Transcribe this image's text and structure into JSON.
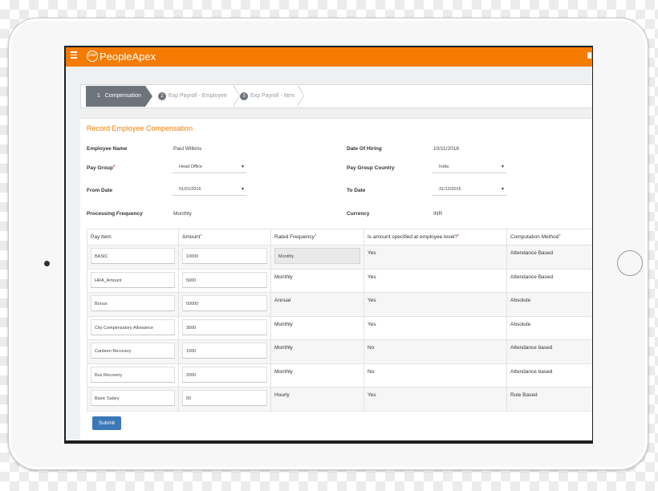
{
  "app": {
    "brand": "PeopleApex",
    "logo_text": "pax"
  },
  "steps": [
    {
      "num": "1",
      "label": "Compensation"
    },
    {
      "num": "2",
      "label": "Exp Payroll - Employee"
    },
    {
      "num": "3",
      "label": "Exp Payroll - Item"
    }
  ],
  "form": {
    "title": "Record Employee Compensation",
    "employee_name_label": "Employee Name",
    "employee_name": "Paul Wilkins",
    "date_of_hiring_label": "Date Of Hiring",
    "date_of_hiring": "10/11/2016",
    "pay_group_label": "Pay Group",
    "pay_group": "Head Office",
    "pay_group_country_label": "Pay Group Country",
    "pay_group_country": "India",
    "from_date_label": "From Date",
    "from_date": "01/01/2016",
    "to_date_label": "To Date",
    "to_date": "31/12/2016",
    "processing_frequency_label": "Processing Frequency",
    "processing_frequency": "Monthly",
    "currency_label": "Currency",
    "currency": "INR",
    "required_mark": "*"
  },
  "table": {
    "headers": [
      "Pay Item",
      "Amount",
      "Rated Frequency",
      "Is amount specified at employee level?",
      "Computation Method"
    ],
    "rows": [
      {
        "pay_item": "BASIC",
        "amount": "10000",
        "frequency": "Monthly",
        "employee_level": "Yes",
        "method": "Attendance Based"
      },
      {
        "pay_item": "HRA_Amount",
        "amount": "5000",
        "frequency": "Monthly",
        "employee_level": "Yes",
        "method": "Attendance Based"
      },
      {
        "pay_item": "Bonus",
        "amount": "50000",
        "frequency": "Annual",
        "employee_level": "Yes",
        "method": "Absolute"
      },
      {
        "pay_item": "City Compensatory Allowance",
        "amount": "3000",
        "frequency": "Monthly",
        "employee_level": "Yes",
        "method": "Absolute"
      },
      {
        "pay_item": "Canteen Recovery",
        "amount": "1000",
        "frequency": "Monthly",
        "employee_level": "No",
        "method": "Attendance based"
      },
      {
        "pay_item": "Bus Recovery",
        "amount": "2000",
        "frequency": "Monthly",
        "employee_level": "No",
        "method": "Attendance based"
      },
      {
        "pay_item": "Basic Salary",
        "amount": "50",
        "frequency": "Hourly",
        "employee_level": "Yes",
        "method": "Rule Based"
      }
    ]
  },
  "submit_label": "Submit",
  "colors": {
    "brand": "#f57c00",
    "step_active": "#6d747c",
    "submit": "#3a78b8",
    "required": "#e53935"
  }
}
